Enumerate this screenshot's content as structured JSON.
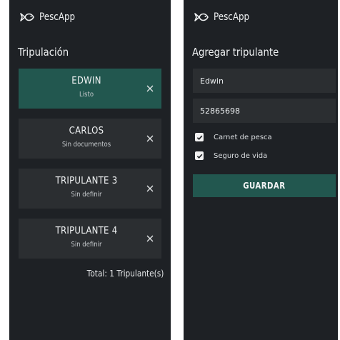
{
  "app": {
    "name": "PescApp",
    "accent_color": "#22574f",
    "background_color": "#1e2125",
    "card_color": "#2b2e31",
    "logo_icon": "fish-outline-icon"
  },
  "crew_screen": {
    "title": "Tripulación",
    "members": [
      {
        "name": "EDWIN",
        "status": "Listo",
        "selected": true
      },
      {
        "name": "CARLOS",
        "status": "Sin documentos",
        "selected": false
      },
      {
        "name": "TRIPULANTE 3",
        "status": "Sin definir",
        "selected": false
      },
      {
        "name": "TRIPULANTE 4",
        "status": "Sin definir",
        "selected": false
      }
    ],
    "remove_icon": "close-icon",
    "total": "Total: 1 Tripulante(s)"
  },
  "add_screen": {
    "title": "Agregar tripulante",
    "name_value": "Edwin",
    "id_value": "52865698",
    "checkboxes": [
      {
        "label": "Carnet de pesca",
        "checked": true
      },
      {
        "label": "Seguro de vida",
        "checked": true
      }
    ],
    "save_label": "GUARDAR"
  }
}
